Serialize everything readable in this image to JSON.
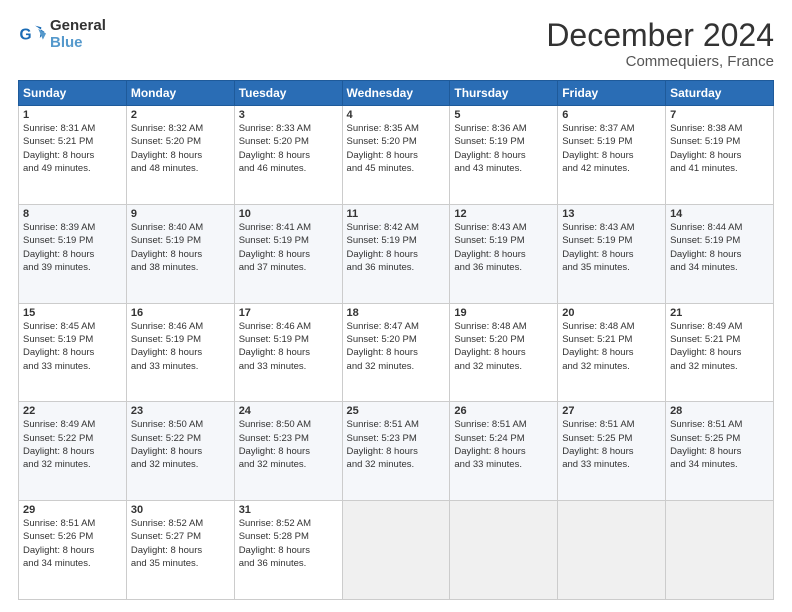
{
  "logo": {
    "line1": "General",
    "line2": "Blue"
  },
  "title": "December 2024",
  "subtitle": "Commequiers, France",
  "days_header": [
    "Sunday",
    "Monday",
    "Tuesday",
    "Wednesday",
    "Thursday",
    "Friday",
    "Saturday"
  ],
  "weeks": [
    [
      {
        "day": "1",
        "lines": [
          "Sunrise: 8:31 AM",
          "Sunset: 5:21 PM",
          "Daylight: 8 hours",
          "and 49 minutes."
        ]
      },
      {
        "day": "2",
        "lines": [
          "Sunrise: 8:32 AM",
          "Sunset: 5:20 PM",
          "Daylight: 8 hours",
          "and 48 minutes."
        ]
      },
      {
        "day": "3",
        "lines": [
          "Sunrise: 8:33 AM",
          "Sunset: 5:20 PM",
          "Daylight: 8 hours",
          "and 46 minutes."
        ]
      },
      {
        "day": "4",
        "lines": [
          "Sunrise: 8:35 AM",
          "Sunset: 5:20 PM",
          "Daylight: 8 hours",
          "and 45 minutes."
        ]
      },
      {
        "day": "5",
        "lines": [
          "Sunrise: 8:36 AM",
          "Sunset: 5:19 PM",
          "Daylight: 8 hours",
          "and 43 minutes."
        ]
      },
      {
        "day": "6",
        "lines": [
          "Sunrise: 8:37 AM",
          "Sunset: 5:19 PM",
          "Daylight: 8 hours",
          "and 42 minutes."
        ]
      },
      {
        "day": "7",
        "lines": [
          "Sunrise: 8:38 AM",
          "Sunset: 5:19 PM",
          "Daylight: 8 hours",
          "and 41 minutes."
        ]
      }
    ],
    [
      {
        "day": "8",
        "lines": [
          "Sunrise: 8:39 AM",
          "Sunset: 5:19 PM",
          "Daylight: 8 hours",
          "and 39 minutes."
        ]
      },
      {
        "day": "9",
        "lines": [
          "Sunrise: 8:40 AM",
          "Sunset: 5:19 PM",
          "Daylight: 8 hours",
          "and 38 minutes."
        ]
      },
      {
        "day": "10",
        "lines": [
          "Sunrise: 8:41 AM",
          "Sunset: 5:19 PM",
          "Daylight: 8 hours",
          "and 37 minutes."
        ]
      },
      {
        "day": "11",
        "lines": [
          "Sunrise: 8:42 AM",
          "Sunset: 5:19 PM",
          "Daylight: 8 hours",
          "and 36 minutes."
        ]
      },
      {
        "day": "12",
        "lines": [
          "Sunrise: 8:43 AM",
          "Sunset: 5:19 PM",
          "Daylight: 8 hours",
          "and 36 minutes."
        ]
      },
      {
        "day": "13",
        "lines": [
          "Sunrise: 8:43 AM",
          "Sunset: 5:19 PM",
          "Daylight: 8 hours",
          "and 35 minutes."
        ]
      },
      {
        "day": "14",
        "lines": [
          "Sunrise: 8:44 AM",
          "Sunset: 5:19 PM",
          "Daylight: 8 hours",
          "and 34 minutes."
        ]
      }
    ],
    [
      {
        "day": "15",
        "lines": [
          "Sunrise: 8:45 AM",
          "Sunset: 5:19 PM",
          "Daylight: 8 hours",
          "and 33 minutes."
        ]
      },
      {
        "day": "16",
        "lines": [
          "Sunrise: 8:46 AM",
          "Sunset: 5:19 PM",
          "Daylight: 8 hours",
          "and 33 minutes."
        ]
      },
      {
        "day": "17",
        "lines": [
          "Sunrise: 8:46 AM",
          "Sunset: 5:19 PM",
          "Daylight: 8 hours",
          "and 33 minutes."
        ]
      },
      {
        "day": "18",
        "lines": [
          "Sunrise: 8:47 AM",
          "Sunset: 5:20 PM",
          "Daylight: 8 hours",
          "and 32 minutes."
        ]
      },
      {
        "day": "19",
        "lines": [
          "Sunrise: 8:48 AM",
          "Sunset: 5:20 PM",
          "Daylight: 8 hours",
          "and 32 minutes."
        ]
      },
      {
        "day": "20",
        "lines": [
          "Sunrise: 8:48 AM",
          "Sunset: 5:21 PM",
          "Daylight: 8 hours",
          "and 32 minutes."
        ]
      },
      {
        "day": "21",
        "lines": [
          "Sunrise: 8:49 AM",
          "Sunset: 5:21 PM",
          "Daylight: 8 hours",
          "and 32 minutes."
        ]
      }
    ],
    [
      {
        "day": "22",
        "lines": [
          "Sunrise: 8:49 AM",
          "Sunset: 5:22 PM",
          "Daylight: 8 hours",
          "and 32 minutes."
        ]
      },
      {
        "day": "23",
        "lines": [
          "Sunrise: 8:50 AM",
          "Sunset: 5:22 PM",
          "Daylight: 8 hours",
          "and 32 minutes."
        ]
      },
      {
        "day": "24",
        "lines": [
          "Sunrise: 8:50 AM",
          "Sunset: 5:23 PM",
          "Daylight: 8 hours",
          "and 32 minutes."
        ]
      },
      {
        "day": "25",
        "lines": [
          "Sunrise: 8:51 AM",
          "Sunset: 5:23 PM",
          "Daylight: 8 hours",
          "and 32 minutes."
        ]
      },
      {
        "day": "26",
        "lines": [
          "Sunrise: 8:51 AM",
          "Sunset: 5:24 PM",
          "Daylight: 8 hours",
          "and 33 minutes."
        ]
      },
      {
        "day": "27",
        "lines": [
          "Sunrise: 8:51 AM",
          "Sunset: 5:25 PM",
          "Daylight: 8 hours",
          "and 33 minutes."
        ]
      },
      {
        "day": "28",
        "lines": [
          "Sunrise: 8:51 AM",
          "Sunset: 5:25 PM",
          "Daylight: 8 hours",
          "and 34 minutes."
        ]
      }
    ],
    [
      {
        "day": "29",
        "lines": [
          "Sunrise: 8:51 AM",
          "Sunset: 5:26 PM",
          "Daylight: 8 hours",
          "and 34 minutes."
        ]
      },
      {
        "day": "30",
        "lines": [
          "Sunrise: 8:52 AM",
          "Sunset: 5:27 PM",
          "Daylight: 8 hours",
          "and 35 minutes."
        ]
      },
      {
        "day": "31",
        "lines": [
          "Sunrise: 8:52 AM",
          "Sunset: 5:28 PM",
          "Daylight: 8 hours",
          "and 36 minutes."
        ]
      },
      null,
      null,
      null,
      null
    ]
  ]
}
